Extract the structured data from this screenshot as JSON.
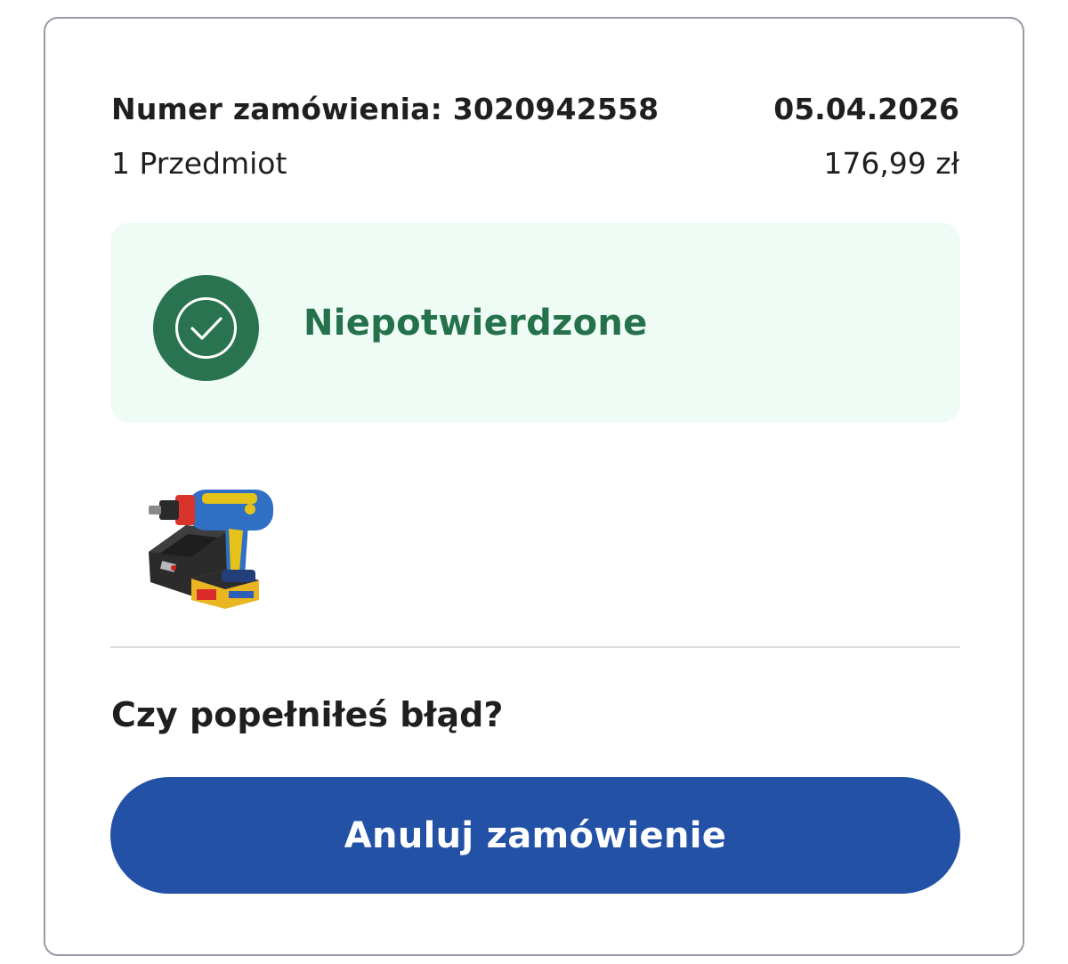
{
  "order": {
    "number_label": "Numer zamówienia: 3020942558",
    "date": "05.04.2026",
    "item_count": "1 Przedmiot",
    "price": "176,99 zł"
  },
  "status": {
    "label": "Niepotwierdzone",
    "icon": "checkmark-circle-icon",
    "background_color": "#effcf6",
    "icon_color": "#2a7350",
    "text_color": "#24714c"
  },
  "product": {
    "image": "cordless-drill-with-charger-and-battery"
  },
  "mistake": {
    "heading": "Czy popełniłeś błąd?"
  },
  "actions": {
    "cancel_label": "Anuluj zamówienie",
    "cancel_color": "#2351a6"
  }
}
